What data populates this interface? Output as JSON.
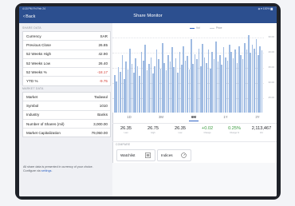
{
  "status_bar": {
    "time_date": "4:15 PM  Fri Feb 24",
    "right": "◈ ▾ 100% ▆"
  },
  "nav": {
    "back_label": "Back",
    "title": "Share Monitor"
  },
  "share_data": {
    "heading": "SHARE DATA",
    "rows": [
      {
        "label": "Currency",
        "value": "SAR"
      },
      {
        "label": "Previous Close",
        "value": "26.85"
      },
      {
        "label": "52 Weeks High",
        "value": "42.90"
      },
      {
        "label": "52 Weeks Low",
        "value": "26.40"
      },
      {
        "label": "52 Weeks %",
        "value": "-18.17"
      },
      {
        "label": "YTD %",
        "value": "-9.75"
      }
    ]
  },
  "market_data": {
    "heading": "MARKET DATA",
    "rows": [
      {
        "label": "Market",
        "value": "Tadawul"
      },
      {
        "label": "Symbol",
        "value": "1010"
      },
      {
        "label": "Industry",
        "value": "Banks"
      },
      {
        "label": "Number of Shares (mil)",
        "value": "3,000.00"
      },
      {
        "label": "Market Capitalization",
        "value": "79,050.00"
      }
    ]
  },
  "note": {
    "text": "All share data is presented in currency of your choice. Configure via ",
    "link": "settings",
    "end": "."
  },
  "chart": {
    "legend": {
      "vol": "Vol",
      "price": "Price"
    },
    "y_labels": [
      "30.00",
      "40.00",
      "35.00",
      "30.00",
      "25.00"
    ],
    "colors": {
      "volume": "#9fbbe2",
      "price_line": "#7fa1d6",
      "accent": "#2f63c4",
      "positive": "#3a9a3d",
      "negative": "#d23b33"
    }
  },
  "chart_data": {
    "type": "bar",
    "series": [
      {
        "name": "Vol",
        "values": [
          34,
          28,
          41,
          37,
          52,
          30,
          46,
          39,
          58,
          44,
          36,
          49,
          42,
          33,
          55,
          47,
          61,
          38,
          44,
          50,
          35,
          42,
          57,
          48,
          40,
          63,
          45,
          38,
          52,
          46,
          59,
          41,
          49,
          36,
          55,
          43,
          60,
          47,
          51,
          39,
          66,
          44,
          53,
          48,
          58,
          42,
          62,
          50,
          45,
          57,
          40,
          55,
          48,
          64,
          46,
          52,
          43,
          59,
          50,
          47,
          61,
          55,
          49,
          57,
          45,
          60,
          52,
          48,
          63,
          57,
          70,
          54,
          61,
          58,
          66,
          52,
          60,
          56
        ]
      }
    ]
  },
  "periods": {
    "items": [
      "1D",
      "3M",
      "6M",
      "1Y",
      "3Y"
    ],
    "selected": "6M"
  },
  "stats": [
    {
      "value": "26.35",
      "label": "Last"
    },
    {
      "value": "26.75",
      "label": "High"
    },
    {
      "value": "26.35",
      "label": "Low"
    },
    {
      "value": "+0.02",
      "label": "Change"
    },
    {
      "value": "0.25%",
      "label": "Change %"
    },
    {
      "value": "2,113,467",
      "label": "Vol."
    }
  ],
  "compare": {
    "heading": "COMPARE",
    "watchlist_label": "Watchlist",
    "indices_label": "Indices"
  }
}
